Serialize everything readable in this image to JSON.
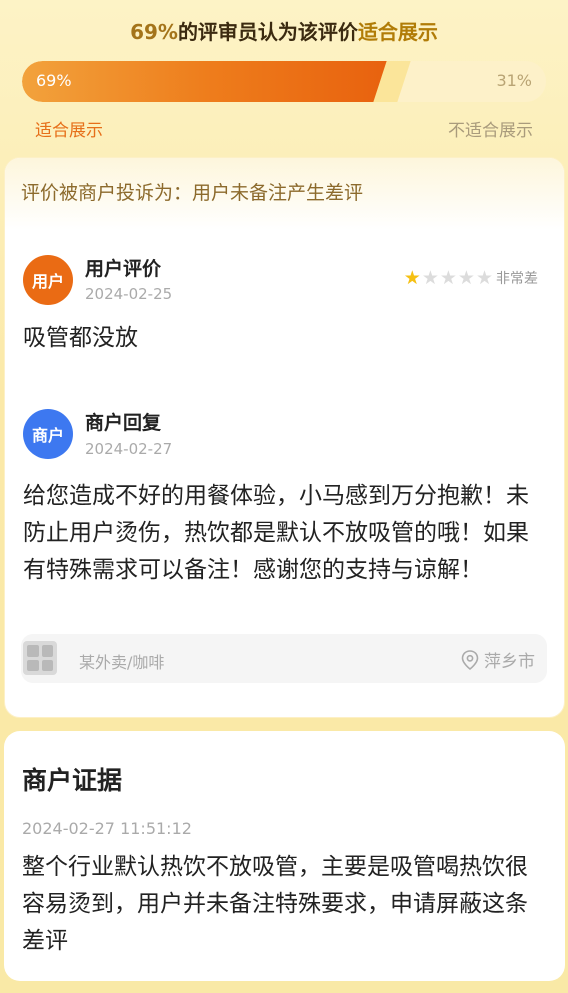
{
  "header": {
    "title_pct": "69%",
    "title_mid": "的评审员认为该评价",
    "title_end": "适合展示"
  },
  "vote": {
    "suitable_pct": 69,
    "suitable_label_pct": "69%",
    "unsuitable_label_pct": "31%",
    "suitable_label": "适合展示",
    "unsuitable_label": "不适合展示",
    "colors": {
      "fill": "#ee7d1c",
      "track": "#fdf1c9"
    }
  },
  "complaint": {
    "text": "评价被商户投诉为：用户未备注产生差评"
  },
  "user_review": {
    "avatar_label": "用户",
    "name": "用户评价",
    "date": "2024-02-25",
    "rating": 1,
    "rating_max": 5,
    "rating_label": "非常差",
    "text": "吸管都没放"
  },
  "merchant_reply": {
    "avatar_label": "商户",
    "name": "商户回复",
    "date": "2024-02-27",
    "text": "给您造成不好的用餐体验，小马感到万分抱歉！未防止用户烫伤，热饮都是默认不放吸管的哦！如果有特殊需求可以备注！感谢您的支持与谅解！"
  },
  "shop": {
    "icon": "shop-thumbnail-icon",
    "name": "某外卖/咖啡",
    "location_icon": "location-pin-icon",
    "location": "萍乡市"
  },
  "evidence": {
    "title": "商户证据",
    "time": "2024-02-27 11:51:12",
    "text": "整个行业默认热饮不放吸管，主要是吸管喝热饮很容易烫到，用户并未备注特殊要求，申请屏蔽这条差评"
  }
}
